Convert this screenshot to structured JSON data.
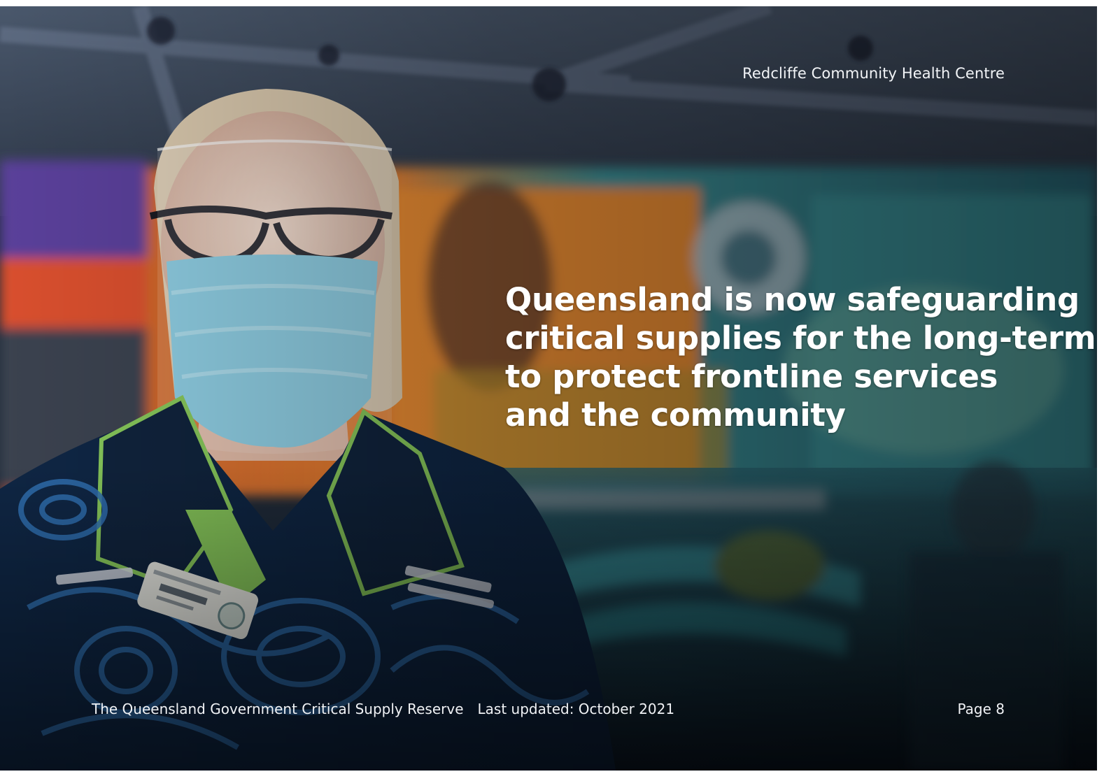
{
  "photo": {
    "subject": "photo-of-health-worker-in-face-shield-and-mask",
    "palette": {
      "canopy": "#3c4a5e",
      "mural_orange": "#e0772c",
      "mural_teal": "#3fa1a6",
      "shirt_navy": "#0f2644",
      "shirt_pattern": "#2f6fb1",
      "mask": "#7ec6de",
      "collar_green": "#86c65a"
    }
  },
  "caption": "Redcliffe Community Health Centre",
  "headline": {
    "lines": [
      "Queensland is now safeguarding",
      "critical supplies for the long-term",
      "to protect frontline services",
      "and the community"
    ]
  },
  "footer": {
    "document_title": "The Queensland Government Critical Supply Reserve",
    "last_updated": "Last updated: October 2021",
    "page_number": "Page 8"
  }
}
